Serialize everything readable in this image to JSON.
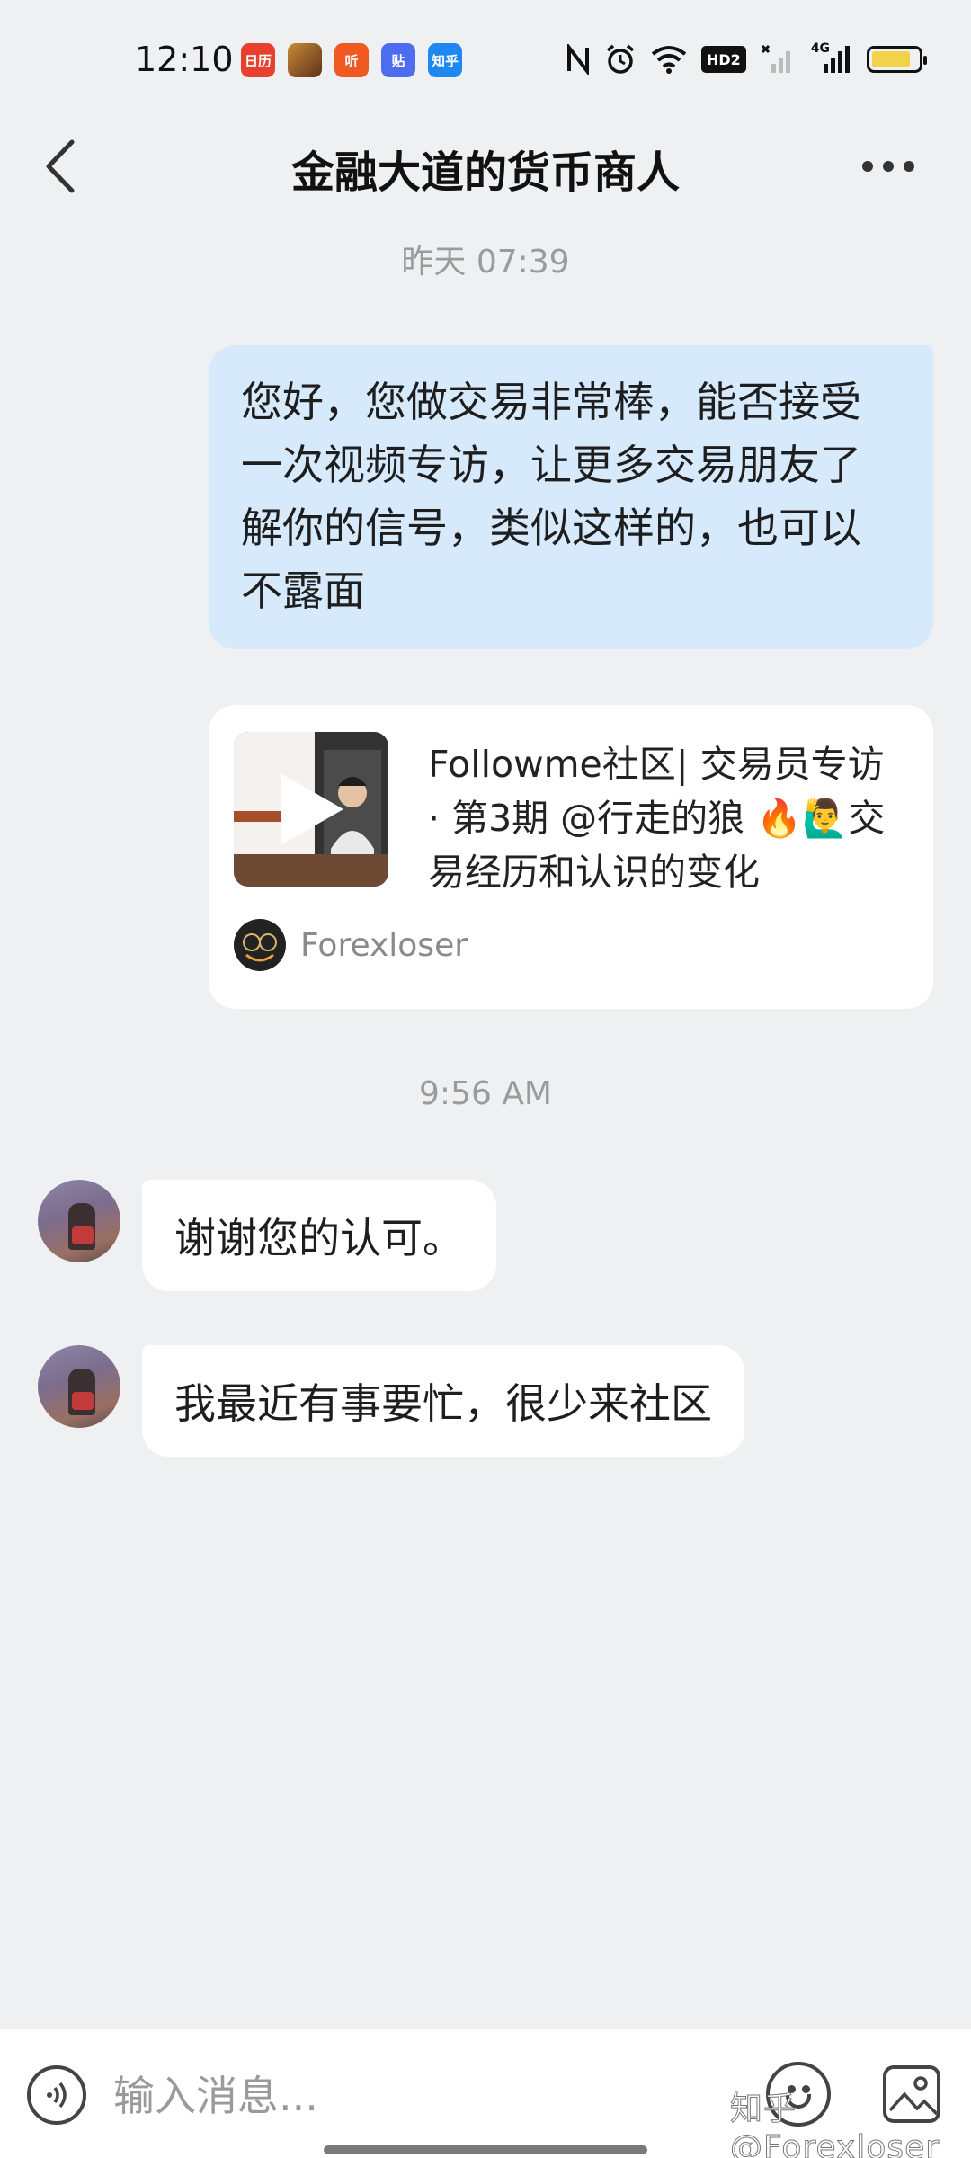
{
  "status_bar": {
    "time": "12:10",
    "notification_apps": [
      {
        "name": "calendar-app-icon",
        "label": "日历",
        "color": "#e8402f"
      },
      {
        "name": "game-app-icon",
        "label": "",
        "color": "#8a5a2b"
      },
      {
        "name": "listen-app-icon",
        "label": "听",
        "color": "#f05a22"
      },
      {
        "name": "tieba-app-icon",
        "label": "贴",
        "color": "#4d6cf0"
      },
      {
        "name": "zhihu-app-icon",
        "label": "知乎",
        "color": "#1e88f0"
      }
    ],
    "network_badge": "HD2",
    "network_type": "4G",
    "battery_level": 0.85,
    "battery_color": "#f2d14b"
  },
  "header": {
    "back_icon": "chevron-left-icon",
    "title": "金融大道的货币商人",
    "more_icon": "more-dots-icon"
  },
  "chat": {
    "timestamp_1": "昨天 07:39",
    "outgoing_message": "您好，您做交易非常棒，能否接受一次视频专访，让更多交易朋友了解你的信号，类似这样的，也可以不露面",
    "shared_card": {
      "title": "Followme社区| 交易员专访 · 第3期 @行走的狼 🔥🙋‍♂️交易经历和认识的变化",
      "author": "Forexloser",
      "play_icon": "play-icon"
    },
    "timestamp_2": "9:56 AM",
    "incoming_messages": [
      {
        "text": "谢谢您的认可。"
      },
      {
        "text": "我最近有事要忙，很少来社区"
      }
    ]
  },
  "input_bar": {
    "placeholder": "输入消息...",
    "voice_icon": "voice-icon",
    "emoji_icon": "emoji-icon",
    "image_icon": "image-icon"
  },
  "watermark": "知乎 @Forexloser",
  "colors": {
    "background": "#eff0f2",
    "outgoing_bubble": "#d6eafc",
    "incoming_bubble": "#ffffff"
  }
}
